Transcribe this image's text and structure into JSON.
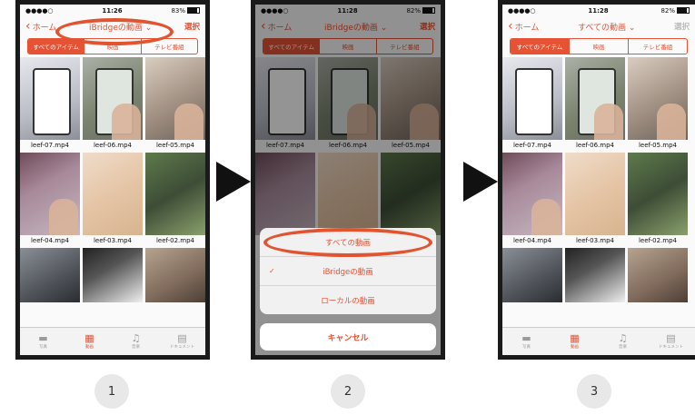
{
  "status": {
    "carrier": "●●●●○",
    "time": "11:26",
    "battery": "83%"
  },
  "status2": {
    "carrier": "●●●●○",
    "time": "11:28",
    "battery": "82%"
  },
  "status3": {
    "carrier": "●●●●○",
    "time": "11:28",
    "battery": "82%"
  },
  "nav": {
    "back": "ホーム",
    "title": "iBridgeの動画 ⌄",
    "title_all": "すべての動画 ⌄",
    "select": "選択"
  },
  "segments": [
    "すべてのアイテム",
    "映画",
    "テレビ番組"
  ],
  "videos": [
    "leef-07.mp4",
    "leef-06.mp4",
    "leef-05.mp4",
    "leef-04.mp4",
    "leef-03.mp4",
    "leef-02.mp4"
  ],
  "tabs": [
    {
      "label": "写真",
      "icon": "photos-icon"
    },
    {
      "label": "動画",
      "icon": "video-icon"
    },
    {
      "label": "音楽",
      "icon": "music-icon"
    },
    {
      "label": "ドキュメント",
      "icon": "document-icon"
    }
  ],
  "sheet": {
    "all": "すべての動画",
    "ibridge": "iBridgeの動画",
    "local": "ローカルの動画",
    "cancel": "キャンセル"
  },
  "steps": [
    "1",
    "2",
    "3"
  ],
  "colors": {
    "accent": "#e55234",
    "highlight": "#e1542f"
  }
}
